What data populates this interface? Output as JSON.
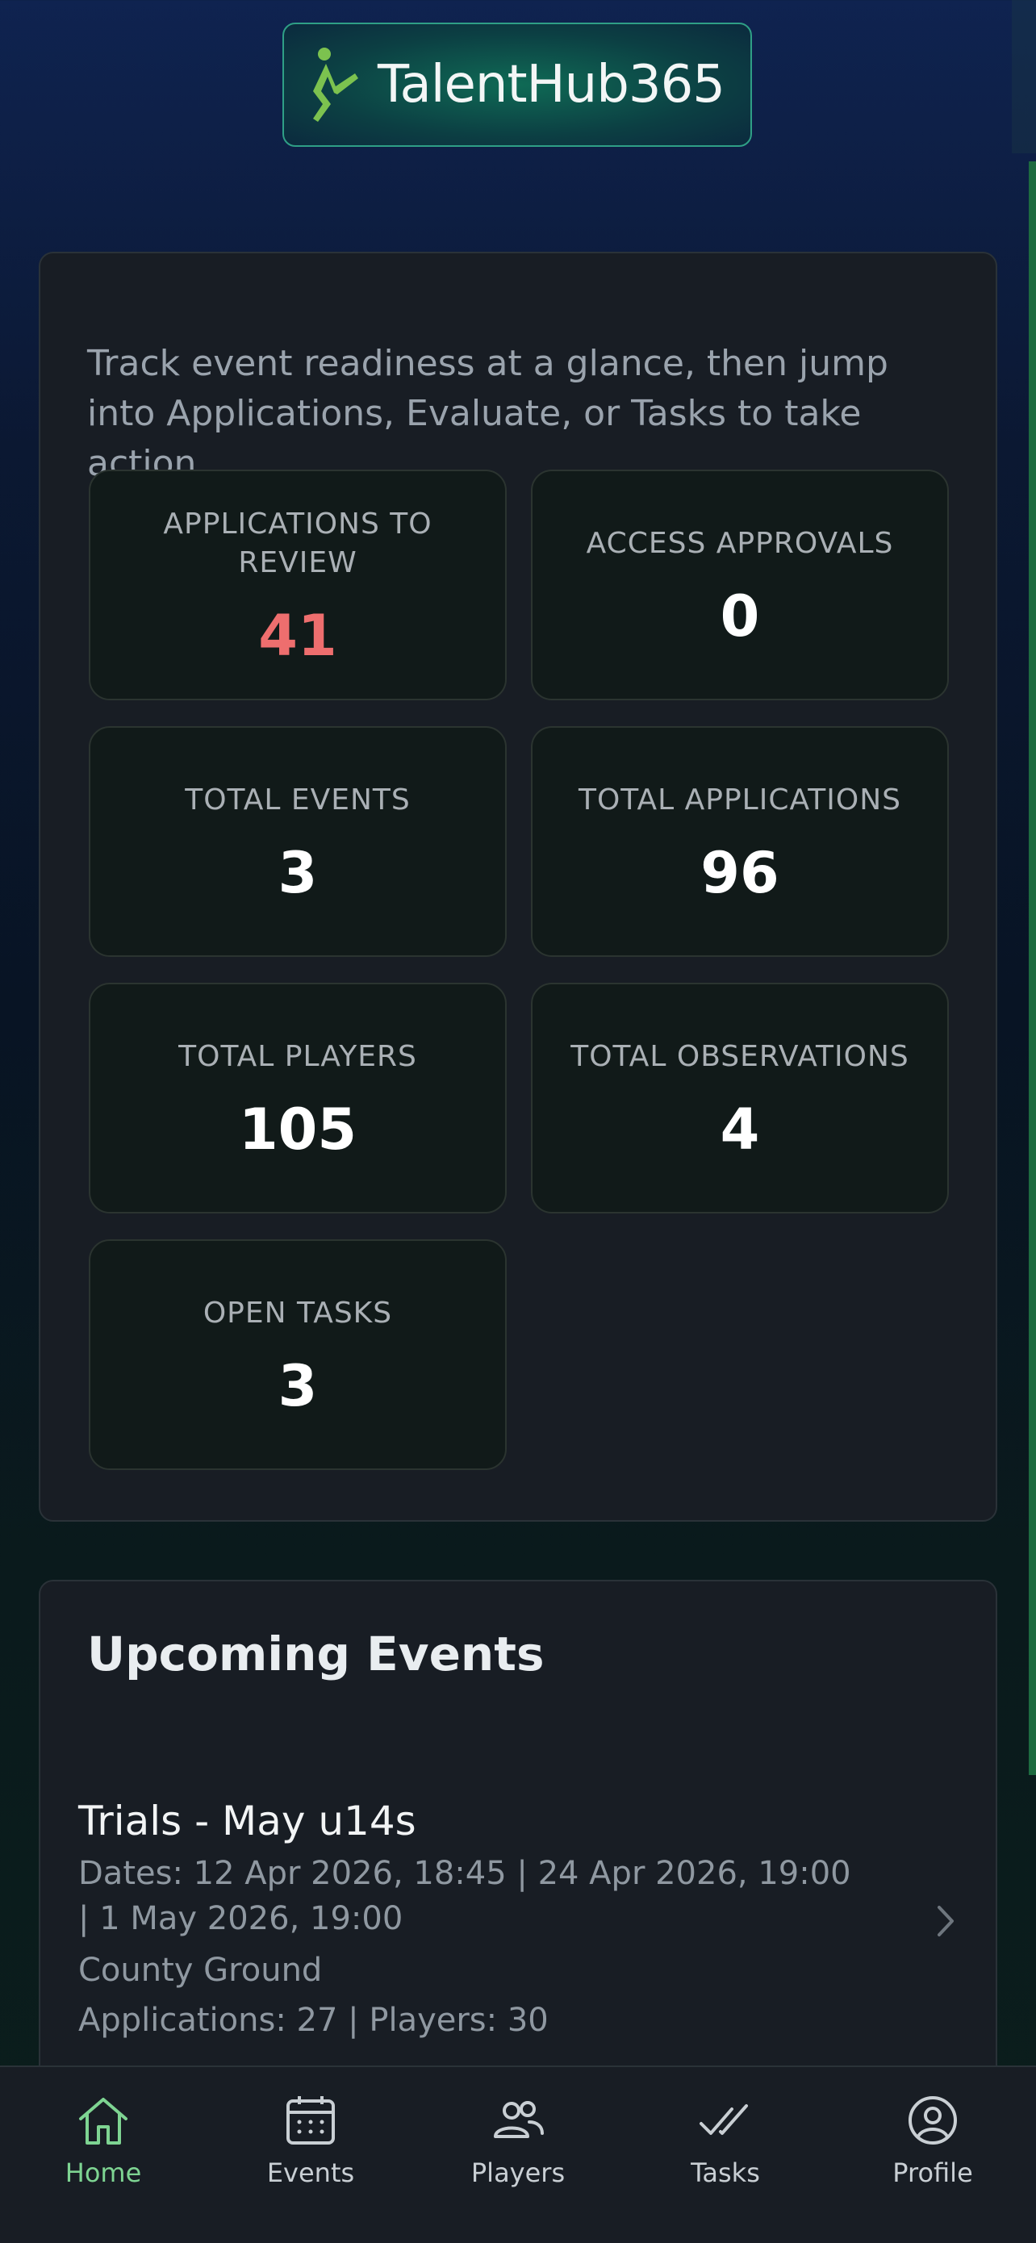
{
  "brand": {
    "logo_text": "TalentHub365"
  },
  "intro": "Track event readiness at a glance, then jump into Applications, Evaluate, or Tasks to take action.",
  "stats": [
    {
      "label": "APPLICATIONS TO REVIEW",
      "value": "41",
      "highlight": true,
      "color": "#ee6e6e"
    },
    {
      "label": "ACCESS APPROVALS",
      "value": "0"
    },
    {
      "label": "TOTAL EVENTS",
      "value": "3"
    },
    {
      "label": "TOTAL APPLICATIONS",
      "value": "96"
    },
    {
      "label": "TOTAL PLAYERS",
      "value": "105"
    },
    {
      "label": "TOTAL OBSERVATIONS",
      "value": "4"
    },
    {
      "label": "OPEN TASKS",
      "value": "3"
    }
  ],
  "upcoming": {
    "title": "Upcoming Events",
    "events": [
      {
        "name": "Trials - May u14s",
        "dates": "Dates: 12 Apr 2026, 18:45 | 24 Apr 2026, 19:00 | 1 May 2026, 19:00",
        "venue": "County Ground",
        "counts": "Applications: 27 | Players: 30"
      }
    ]
  },
  "tabbar": {
    "items": [
      {
        "label": "Home",
        "icon": "home-icon",
        "active": true
      },
      {
        "label": "Events",
        "icon": "calendar-icon"
      },
      {
        "label": "Players",
        "icon": "players-icon"
      },
      {
        "label": "Tasks",
        "icon": "double-check-icon"
      },
      {
        "label": "Profile",
        "icon": "profile-icon"
      }
    ]
  },
  "colors": {
    "accent": "#7ed492",
    "alert": "#ee6e6e",
    "card": "#181d24"
  }
}
